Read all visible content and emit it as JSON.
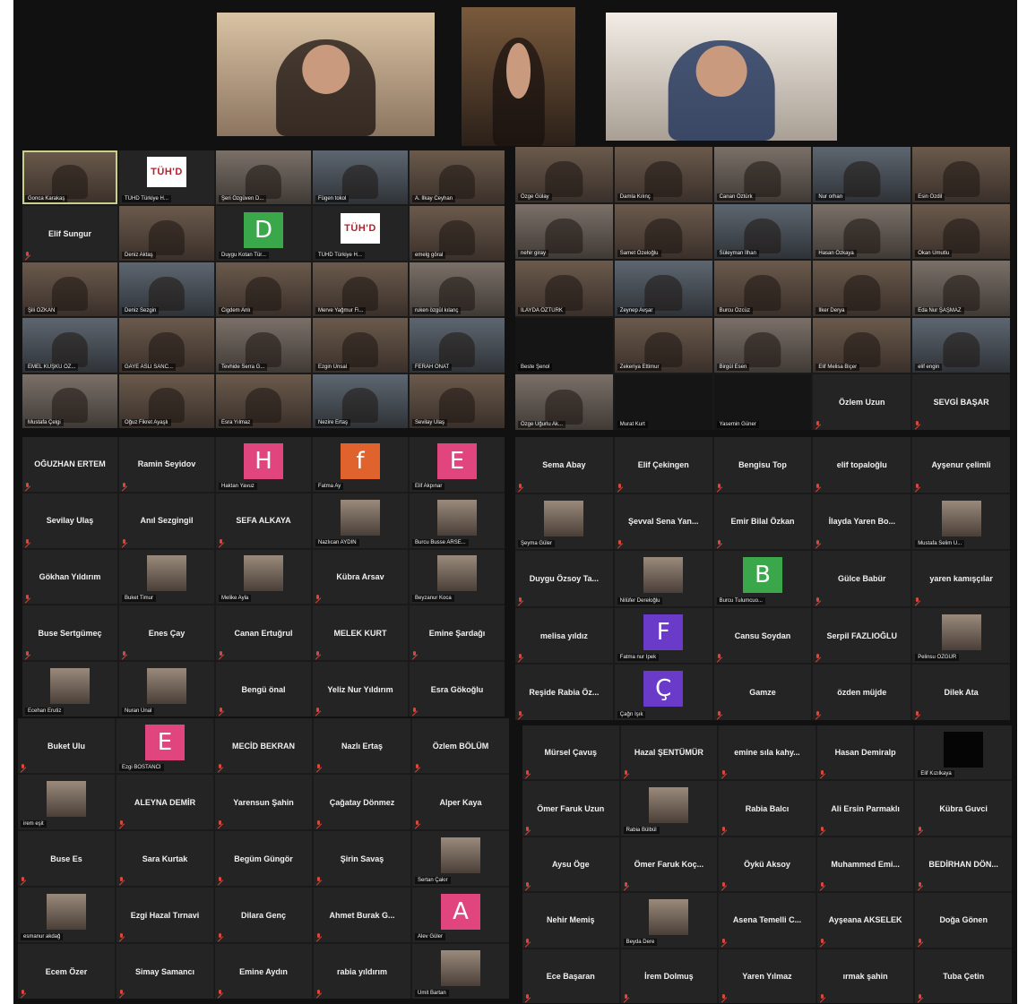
{
  "colors": {
    "page_bg": "#111111",
    "active_speaker_border": "#c8d08a",
    "muted_icon": "#e0453a"
  },
  "speakers": [
    {
      "icon": "video-feed"
    },
    {
      "icon": "video-feed"
    },
    {
      "icon": "video-feed"
    }
  ],
  "galleries": [
    {
      "tiles": [
        {
          "name": "Gonca Karakaş",
          "kind": "video",
          "active": true
        },
        {
          "name": "TÜHD Türkiye H...",
          "kind": "logo",
          "logo": "TÜH'D"
        },
        {
          "name": "Şeri Özgüven D...",
          "kind": "video"
        },
        {
          "name": "Fügen tokol",
          "kind": "video"
        },
        {
          "name": "A. İlkay Ceyhan",
          "kind": "video"
        },
        {
          "name": "Elif Sungur",
          "kind": "text"
        },
        {
          "name": "Deniz Aktaş",
          "kind": "video"
        },
        {
          "name": "Duygu Kotan Tür...",
          "kind": "avatar",
          "letter": "D",
          "color": "#3aa84a"
        },
        {
          "name": "TÜHD Türkiye H...",
          "kind": "logo",
          "logo": "TÜH'D"
        },
        {
          "name": "emelg göral",
          "kind": "video"
        },
        {
          "name": "Şili ÖZKAN",
          "kind": "video"
        },
        {
          "name": "Deniz Sezgin",
          "kind": "video"
        },
        {
          "name": "Cigdem Anlı",
          "kind": "video"
        },
        {
          "name": "Merve Yağmur Fi...",
          "kind": "video"
        },
        {
          "name": "ruken özgül kılanç",
          "kind": "video"
        },
        {
          "name": "EMEL KUŞKU ÖZ...",
          "kind": "video"
        },
        {
          "name": "GAYE ASLI SANC...",
          "kind": "video"
        },
        {
          "name": "Tevhide Serra G...",
          "kind": "video"
        },
        {
          "name": "Ezgin Ünsal",
          "kind": "video"
        },
        {
          "name": "FERAH ONAT",
          "kind": "video"
        },
        {
          "name": "Mustafa Çelgi",
          "kind": "video"
        },
        {
          "name": "Oğuz Fikret Ayaşlı",
          "kind": "video"
        },
        {
          "name": "Esra Yılmaz",
          "kind": "video"
        },
        {
          "name": "Nezire Ertaş",
          "kind": "video"
        },
        {
          "name": "Sevilay Ulaş",
          "kind": "video"
        }
      ]
    },
    {
      "tiles": [
        {
          "name": "Özge Gülay",
          "kind": "video"
        },
        {
          "name": "Damla Kılınç",
          "kind": "video"
        },
        {
          "name": "Canan Öztürk",
          "kind": "video"
        },
        {
          "name": "Nur orhan",
          "kind": "video"
        },
        {
          "name": "Esin Özdil",
          "kind": "video"
        },
        {
          "name": "nehir giray",
          "kind": "video"
        },
        {
          "name": "Samet Özeloğlu",
          "kind": "video"
        },
        {
          "name": "Süleyman İlhan",
          "kind": "video"
        },
        {
          "name": "Hasan Özkaya",
          "kind": "video"
        },
        {
          "name": "Okan Umutlu",
          "kind": "video"
        },
        {
          "name": "İLAYDA ÖZTÜRK",
          "kind": "video"
        },
        {
          "name": "Zeynep Avşar",
          "kind": "video"
        },
        {
          "name": "Burcu Özcüz",
          "kind": "video"
        },
        {
          "name": "İlker Derya",
          "kind": "video"
        },
        {
          "name": "Eda Nur ŞAŞMAZ",
          "kind": "video"
        },
        {
          "name": "Beste Şenol",
          "kind": "dark"
        },
        {
          "name": "Zekeriya Ettimur",
          "kind": "video"
        },
        {
          "name": "Birgül Esen",
          "kind": "video"
        },
        {
          "name": "Elif Melisa Biçer",
          "kind": "video"
        },
        {
          "name": "elif engin",
          "kind": "video"
        },
        {
          "name": "Özge Uğurlu Ak...",
          "kind": "video"
        },
        {
          "name": "Murat Kurt",
          "kind": "dark"
        },
        {
          "name": "Yasemin Güner",
          "kind": "dark"
        },
        {
          "name": "Özlem Uzun",
          "kind": "text"
        },
        {
          "name": "SEVGİ BAŞAR",
          "kind": "text"
        }
      ]
    },
    {
      "tiles": [
        {
          "name": "OĞUZHAN ERTEM",
          "kind": "text"
        },
        {
          "name": "Ramin Seyidov",
          "kind": "text"
        },
        {
          "name": "Haktan Yavuz",
          "kind": "avatar",
          "letter": "H",
          "color": "#e0457e"
        },
        {
          "name": "Fatma Ay",
          "kind": "avatar",
          "letter": "f",
          "color": "#e0622c"
        },
        {
          "name": "Elif Akpınar",
          "kind": "avatar",
          "letter": "E",
          "color": "#e0457e"
        },
        {
          "name": "Sevilay Ulaş",
          "kind": "text"
        },
        {
          "name": "Anıl Sezgingil",
          "kind": "text"
        },
        {
          "name": "SEFA ALKAYA",
          "kind": "text"
        },
        {
          "name": "Nazlıcan AYDIN",
          "kind": "thumb"
        },
        {
          "name": "Burcu Busse ARSE...",
          "kind": "thumb"
        },
        {
          "name": "Gökhan Yıldırım",
          "kind": "text"
        },
        {
          "name": "Buket Timur",
          "kind": "thumb"
        },
        {
          "name": "Melike Ayla",
          "kind": "thumb"
        },
        {
          "name": "Kübra Arsav",
          "kind": "text"
        },
        {
          "name": "Beyzanur Koca",
          "kind": "thumb"
        },
        {
          "name": "Buse Sertgümeç",
          "kind": "text"
        },
        {
          "name": "Enes Çay",
          "kind": "text"
        },
        {
          "name": "Canan Ertuğrul",
          "kind": "text"
        },
        {
          "name": "MELEK KURT",
          "kind": "text"
        },
        {
          "name": "Emine Şardağı",
          "kind": "text"
        },
        {
          "name": "Ecehan Erutiz",
          "kind": "thumb"
        },
        {
          "name": "Nuran Ünal",
          "kind": "thumb"
        },
        {
          "name": "Bengü önal",
          "kind": "text"
        },
        {
          "name": "Yeliz Nur Yıldırım",
          "kind": "text"
        },
        {
          "name": "Esra Gökoğlu",
          "kind": "text"
        }
      ]
    },
    {
      "tiles": [
        {
          "name": "Sema Abay",
          "kind": "text"
        },
        {
          "name": "Elif Çekingen",
          "kind": "text"
        },
        {
          "name": "Bengisu Top",
          "kind": "text"
        },
        {
          "name": "elif topaloğlu",
          "kind": "text"
        },
        {
          "name": "Ayşenur çelimli",
          "kind": "text"
        },
        {
          "name": "Şeyma Güler",
          "kind": "thumb"
        },
        {
          "name": "Şevval Sena Yan...",
          "kind": "text"
        },
        {
          "name": "Emir Bilal Özkan",
          "kind": "text"
        },
        {
          "name": "İlayda Yaren Bo...",
          "kind": "text"
        },
        {
          "name": "Mustafa Selim U...",
          "kind": "thumb"
        },
        {
          "name": "Duygu Özsoy Ta...",
          "kind": "text"
        },
        {
          "name": "Nilüfer Dereloğlu",
          "kind": "thumb"
        },
        {
          "name": "Burcu Tulumcuo...",
          "kind": "avatar",
          "letter": "B",
          "color": "#3aa84a"
        },
        {
          "name": "Gülce Babür",
          "kind": "text"
        },
        {
          "name": "yaren kamışçılar",
          "kind": "text"
        },
        {
          "name": "melisa yıldız",
          "kind": "text"
        },
        {
          "name": "Fatma nur İpek",
          "kind": "avatar",
          "letter": "F",
          "color": "#6a3ac8"
        },
        {
          "name": "Cansu Soydan",
          "kind": "text"
        },
        {
          "name": "Serpil FAZLIOĞLU",
          "kind": "text"
        },
        {
          "name": "Pelinsu ÖZGÜR",
          "kind": "thumb"
        },
        {
          "name": "Reşide Rabia Öz...",
          "kind": "text"
        },
        {
          "name": "Çağrı Işık",
          "kind": "avatar",
          "letter": "Ç",
          "color": "#6a3ac8"
        },
        {
          "name": "Gamze",
          "kind": "text"
        },
        {
          "name": "özden müjde",
          "kind": "text"
        },
        {
          "name": "Dilek Ata",
          "kind": "text"
        }
      ]
    },
    {
      "tiles": [
        {
          "name": "Buket Ulu",
          "kind": "text"
        },
        {
          "name": "Ezgi BOSTANCI",
          "kind": "avatar",
          "letter": "E",
          "color": "#e0457e"
        },
        {
          "name": "MECİD BEKRAN",
          "kind": "text"
        },
        {
          "name": "Nazlı Ertaş",
          "kind": "text"
        },
        {
          "name": "Özlem BÖLÜM",
          "kind": "text"
        },
        {
          "name": "irem eşit",
          "kind": "thumb"
        },
        {
          "name": "ALEYNA DEMİR",
          "kind": "text"
        },
        {
          "name": "Yarensun Şahin",
          "kind": "text"
        },
        {
          "name": "Çağatay Dönmez",
          "kind": "text"
        },
        {
          "name": "Alper Kaya",
          "kind": "text"
        },
        {
          "name": "Buse Es",
          "kind": "text"
        },
        {
          "name": "Sara Kurtak",
          "kind": "text"
        },
        {
          "name": "Begüm Güngör",
          "kind": "text"
        },
        {
          "name": "Şirin Savaş",
          "kind": "text"
        },
        {
          "name": "Sertan Çakır",
          "kind": "thumb"
        },
        {
          "name": "esmanur akdağ",
          "kind": "thumb"
        },
        {
          "name": "Ezgi Hazal Tırnavi",
          "kind": "text"
        },
        {
          "name": "Dilara Genç",
          "kind": "text"
        },
        {
          "name": "Ahmet Burak G...",
          "kind": "text"
        },
        {
          "name": "Alev Güler",
          "kind": "avatar",
          "letter": "A",
          "color": "#e0457e"
        },
        {
          "name": "Ecem Özer",
          "kind": "text"
        },
        {
          "name": "Simay Samancı",
          "kind": "text"
        },
        {
          "name": "Emine Aydın",
          "kind": "text"
        },
        {
          "name": "rabia yıldırım",
          "kind": "text"
        },
        {
          "name": "Ümit Bartan",
          "kind": "thumb"
        }
      ]
    },
    {
      "tiles": [
        {
          "name": "Mürsel Çavuş",
          "kind": "text"
        },
        {
          "name": "Hazal ŞENTÜMÜR",
          "kind": "text"
        },
        {
          "name": "emine sıla kahy...",
          "kind": "text"
        },
        {
          "name": "Hasan Demiralp",
          "kind": "text"
        },
        {
          "name": "Elif Kızılkaya",
          "kind": "thumb-dark"
        },
        {
          "name": "Ömer Faruk Uzun",
          "kind": "text"
        },
        {
          "name": "Rabia Bülbül",
          "kind": "thumb"
        },
        {
          "name": "Rabia Balcı",
          "kind": "text"
        },
        {
          "name": "Ali Ersin Parmaklı",
          "kind": "text"
        },
        {
          "name": "Kübra Guvci",
          "kind": "text"
        },
        {
          "name": "Aysu Öge",
          "kind": "text"
        },
        {
          "name": "Ömer Faruk Koç...",
          "kind": "text"
        },
        {
          "name": "Öykü Aksoy",
          "kind": "text"
        },
        {
          "name": "Muhammed Emi...",
          "kind": "text"
        },
        {
          "name": "BEDİRHAN DÖN...",
          "kind": "text"
        },
        {
          "name": "Nehir Memiş",
          "kind": "text"
        },
        {
          "name": "Beyda Dere",
          "kind": "thumb"
        },
        {
          "name": "Asena Temelli C...",
          "kind": "text"
        },
        {
          "name": "Ayşeana AKSELEK",
          "kind": "text"
        },
        {
          "name": "Doğa Gönen",
          "kind": "text"
        },
        {
          "name": "Ece Başaran",
          "kind": "text"
        },
        {
          "name": "İrem Dolmuş",
          "kind": "text"
        },
        {
          "name": "Yaren Yılmaz",
          "kind": "text"
        },
        {
          "name": "ırmak şahin",
          "kind": "text"
        },
        {
          "name": "Tuba Çetin",
          "kind": "text"
        }
      ]
    }
  ]
}
